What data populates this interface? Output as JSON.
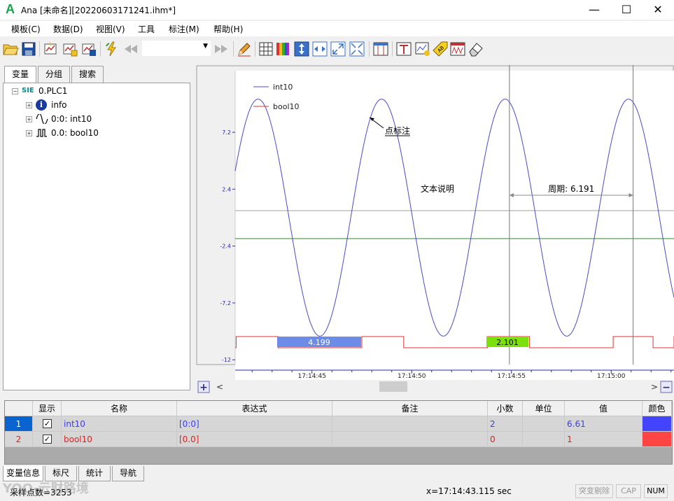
{
  "window": {
    "logo": "A",
    "title": "Ana  [未命名][20220603171241.ihm*]",
    "minimize": "—",
    "maximize": "☐",
    "close": "✕"
  },
  "menu": [
    "模板(C)",
    "数据(D)",
    "视图(V)",
    "工具",
    "标注(M)",
    "帮助(H)"
  ],
  "toolbar": {
    "combo_value": "",
    "icons": [
      "open-folder-icon",
      "save-icon",
      "chart-add-icon",
      "chart-new-icon",
      "chart-save-icon",
      "refresh-lightning-icon",
      "rewind-icon",
      "fast-forward-icon",
      "pencil-icon",
      "grid-icon",
      "color-palette-icon",
      "fit-vertical-icon",
      "fit-horizontal-icon",
      "zoom-in-icon",
      "zoom-out-icon",
      "cursor-icon",
      "marker-icon",
      "annotate-icon",
      "tag-icon",
      "chart-wave-icon",
      "eraser-icon"
    ]
  },
  "left_tabs": [
    "变量",
    "分组",
    "搜索"
  ],
  "tree": {
    "root_prefix": "SIE",
    "root": "0.PLC1",
    "children": [
      "info",
      "0:0: int10",
      "0.0: bool10"
    ]
  },
  "chart": {
    "legend": [
      {
        "name": "int10",
        "color": "#4a4acc"
      },
      {
        "name": "bool10",
        "color": "#e03030"
      }
    ],
    "y_ticks": [
      "7.2",
      "2.4",
      "-2.4",
      "-7.2",
      "-12"
    ],
    "x_ticks": [
      "17:14:45",
      "17:14:50",
      "17:14:55",
      "17:15:00"
    ],
    "annotation_point": "点标注",
    "annotation_text": "文本说明",
    "period_label": "周期: 6.191",
    "bool_label_1": "4.199",
    "bool_label_2": "2.101"
  },
  "chart_data": {
    "type": "line",
    "series": [
      {
        "name": "int10",
        "kind": "sine",
        "amplitude": 10,
        "period_s": 6.191,
        "first_peak": "17:14:42.30",
        "color": "#4a4acc"
      },
      {
        "name": "bool10",
        "kind": "step",
        "color": "#e03030",
        "high_intervals": [
          [
            "17:14:41.2",
            "17:14:43.3"
          ],
          [
            "17:14:47.5",
            "17:14:49.6"
          ],
          [
            "17:14:53.8",
            "17:14:55.9"
          ],
          [
            "17:15:00.1",
            "17:15:02.1"
          ],
          [
            "17:15:06.1",
            "17:15:07.0"
          ]
        ]
      }
    ],
    "x_range": [
      "17:14:41.15",
      "17:15:03.15"
    ],
    "y_range": [
      -12.4,
      12.4
    ],
    "annotation_point": {
      "time": "17:14:47.3",
      "value": 8
    },
    "cursors": [
      "17:14:54.9",
      "17:15:01.1"
    ]
  },
  "grid": {
    "headers": [
      "显示",
      "名称",
      "表达式",
      "备注",
      "小数",
      "单位",
      "值",
      "颜色"
    ],
    "rows": [
      {
        "index": "1",
        "checked": "✓",
        "name": "int10",
        "expr": "[0:0]",
        "note": "",
        "decimals": "2",
        "unit": "",
        "value": "6.61",
        "color": "#4444ff",
        "text_color": "#3a3aff"
      },
      {
        "index": "2",
        "checked": "✓",
        "name": "bool10",
        "expr": "[0.0]",
        "note": "",
        "decimals": "0",
        "unit": "",
        "value": "1",
        "color": "#ff4444",
        "text_color": "#e02020"
      }
    ]
  },
  "bottom_tabs": [
    "变量信息",
    "标尺",
    "统计",
    "导航"
  ],
  "status": {
    "points": "采样点数=3253",
    "cursor": "x=17:14:43.115 sec",
    "mutation": "突变剔除",
    "cap": "CAP",
    "num": "NUM",
    "watermark": "YOO-云财路境"
  },
  "nav": {
    "prev": "<",
    "next": ">",
    "plus": "+",
    "minus": "−"
  }
}
